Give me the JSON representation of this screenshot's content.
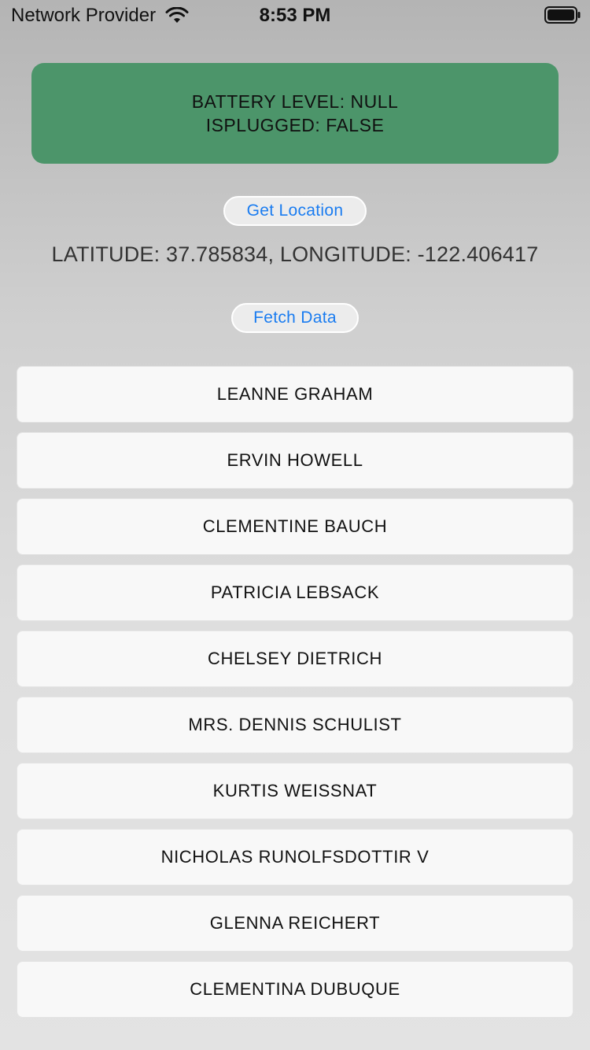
{
  "status_bar": {
    "carrier": "Network Provider",
    "time": "8:53 PM",
    "icons": [
      "wifi-icon",
      "battery-icon"
    ]
  },
  "battery_card": {
    "level_text": "BATTERY LEVEL: NULL",
    "plugged_text": "ISPLUGGED: FALSE",
    "background_color": "#4c956a"
  },
  "location": {
    "button_label": "Get Location",
    "coordinates_text": "LATITUDE: 37.785834, LONGITUDE: -122.406417"
  },
  "fetch": {
    "button_label": "Fetch Data"
  },
  "accent_color": "#1a7cf0",
  "users": [
    "LEANNE GRAHAM",
    "ERVIN HOWELL",
    "CLEMENTINE BAUCH",
    "PATRICIA LEBSACK",
    "CHELSEY DIETRICH",
    "MRS. DENNIS SCHULIST",
    "KURTIS WEISSNAT",
    "NICHOLAS RUNOLFSDOTTIR V",
    "GLENNA REICHERT",
    "CLEMENTINA DUBUQUE"
  ]
}
